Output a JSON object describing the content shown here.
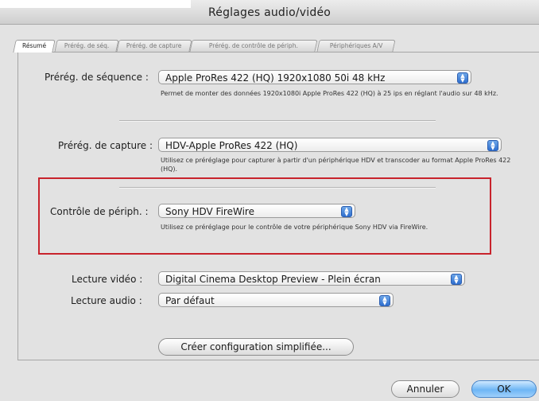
{
  "window": {
    "title": "Réglages audio/vidéo"
  },
  "tabs": [
    {
      "label": "Résumé",
      "active": true
    },
    {
      "label": "Prérég. de séq.",
      "active": false
    },
    {
      "label": "Prérég. de capture",
      "active": false
    },
    {
      "label": "Prérég. de contrôle de périph.",
      "active": false
    },
    {
      "label": "Périphériques A/V",
      "active": false
    }
  ],
  "sequence": {
    "label": "Prérég. de séquence :",
    "value": "Apple ProRes 422 (HQ) 1920x1080 50i 48 kHz",
    "description": "Permet de monter des données 1920x1080i Apple ProRes 422 (HQ) à 25 ips en réglant l'audio sur 48 kHz."
  },
  "capture": {
    "label": "Prérég. de capture :",
    "value": "HDV-Apple ProRes 422 (HQ)",
    "description": "Utilisez ce préréglage pour capturer à partir d'un périphérique HDV et transcoder au format Apple ProRes 422 (HQ)."
  },
  "device_control": {
    "label": "Contrôle de périph. :",
    "value": "Sony HDV FireWire",
    "description": "Utilisez ce préréglage pour le contrôle de votre périphérique Sony HDV via FireWire."
  },
  "video_playback": {
    "label": "Lecture vidéo :",
    "value": "Digital Cinema Desktop Preview - Plein écran"
  },
  "audio_playback": {
    "label": "Lecture audio :",
    "value": "Par défaut"
  },
  "buttons": {
    "simple_setup": "Créer configuration simplifiée...",
    "cancel": "Annuler",
    "ok": "OK"
  },
  "colors": {
    "highlight": "#c8232c",
    "accent": "#3b7fd6"
  }
}
